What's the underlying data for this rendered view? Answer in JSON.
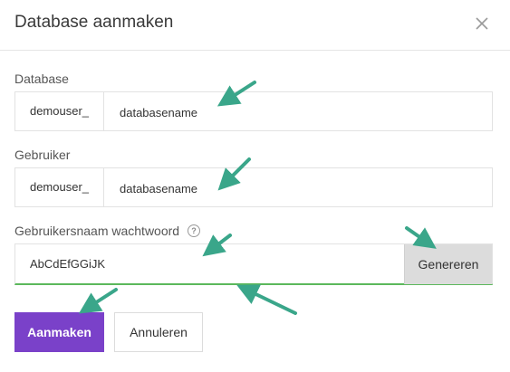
{
  "dialog": {
    "title": "Database aanmaken",
    "close_icon": "close-icon"
  },
  "database": {
    "label": "Database",
    "prefix": "demouser_",
    "value": "databasename"
  },
  "user": {
    "label": "Gebruiker",
    "prefix": "demouser_",
    "value": "databasename"
  },
  "password": {
    "label": "Gebruikersnaam wachtwoord",
    "help_icon": "help-circle-icon",
    "help_glyph": "?",
    "value": "AbCdEfGGiJK",
    "generate_label": "Genereren"
  },
  "actions": {
    "create_label": "Aanmaken",
    "cancel_label": "Annuleren"
  },
  "colors": {
    "primary": "#7a41c9",
    "valid_underline": "#5cb85c",
    "annotation_arrow": "#3aa68a"
  }
}
